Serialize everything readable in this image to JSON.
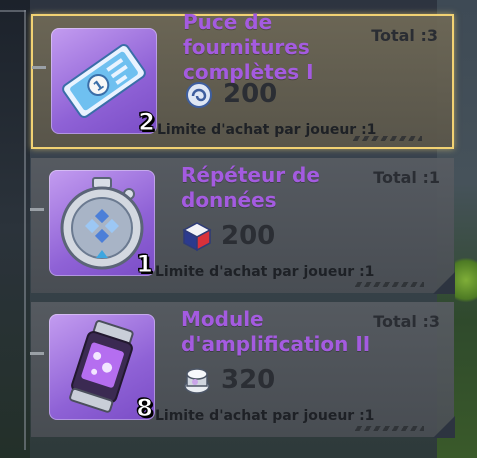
{
  "shop": {
    "items": [
      {
        "name": "Puce de fournitures complètes I",
        "total": "Total :3",
        "qty": "2",
        "price": "200",
        "currency_icon": "spiral-token-icon",
        "limit": "Limite d'achat par joueur :1",
        "item_icon": "ticket-chip-icon",
        "selected": true
      },
      {
        "name": "Répéteur de données",
        "total": "Total :1",
        "qty": "1",
        "price": "200",
        "currency_icon": "cube-token-icon",
        "limit": "Limite d'achat par joueur :1",
        "item_icon": "data-repeater-icon",
        "selected": false
      },
      {
        "name": "Module d'amplification II",
        "total": "Total :3",
        "qty": "8",
        "price": "320",
        "currency_icon": "canister-token-icon",
        "limit": "Limite d'achat par joueur :1",
        "item_icon": "amplifier-canister-icon",
        "selected": false
      }
    ]
  },
  "colors": {
    "title": "#a45be0",
    "selected_border": "#f2d273",
    "icon_bg": "#9d6fe0"
  }
}
